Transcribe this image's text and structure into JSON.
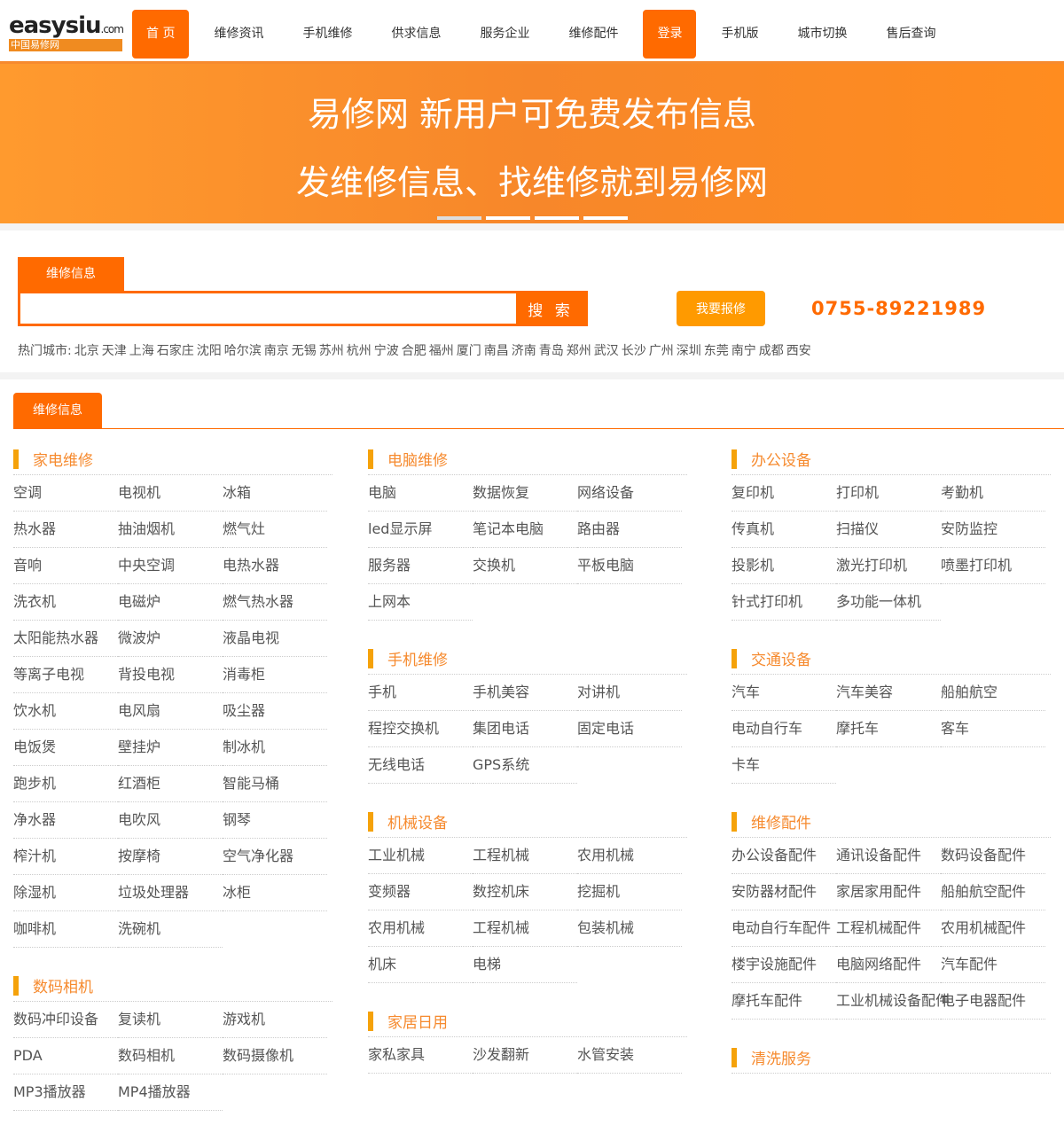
{
  "logo": {
    "text": "easysiu",
    "suffix": ".com",
    "sub": "中国易修网"
  },
  "nav": [
    "首 页",
    "维修资讯",
    "手机维修",
    "供求信息",
    "服务企业",
    "维修配件",
    "登录",
    "手机版",
    "城市切换",
    "售后查询"
  ],
  "nav_active": [
    0,
    6
  ],
  "banner": {
    "line1": "易修网 新用户可免费发布信息",
    "line2": "发维修信息、找维修就到易修网"
  },
  "search": {
    "tab": "维修信息",
    "placeholder": "",
    "button": "搜 索",
    "report": "我要报修",
    "phone": "0755-89221989"
  },
  "hot": {
    "label": "热门城市:",
    "cities": [
      "北京",
      "天津",
      "上海",
      "石家庄",
      "沈阳",
      "哈尔滨",
      "南京",
      "无锡",
      "苏州",
      "杭州",
      "宁波",
      "合肥",
      "福州",
      "厦门",
      "南昌",
      "济南",
      "青岛",
      "郑州",
      "武汉",
      "长沙",
      "广州",
      "深圳",
      "东莞",
      "南宁",
      "成都",
      "西安"
    ]
  },
  "main": {
    "tab": "维修信息"
  },
  "columns": [
    [
      {
        "title": "家电维修",
        "items": [
          "空调",
          "电视机",
          "冰箱",
          "热水器",
          "抽油烟机",
          "燃气灶",
          "音响",
          "中央空调",
          "电热水器",
          "洗衣机",
          "电磁炉",
          "燃气热水器",
          "太阳能热水器",
          "微波炉",
          "液晶电视",
          "等离子电视",
          "背投电视",
          "消毒柜",
          "饮水机",
          "电风扇",
          "吸尘器",
          "电饭煲",
          "壁挂炉",
          "制冰机",
          "跑步机",
          "红酒柜",
          "智能马桶",
          "净水器",
          "电吹风",
          "钢琴",
          "榨汁机",
          "按摩椅",
          "空气净化器",
          "除湿机",
          "垃圾处理器",
          "冰柜",
          "咖啡机",
          "洗碗机"
        ]
      },
      {
        "title": "数码相机",
        "items": [
          "数码冲印设备",
          "复读机",
          "游戏机",
          "PDA",
          "数码相机",
          "数码摄像机",
          "MP3播放器",
          "MP4播放器"
        ]
      }
    ],
    [
      {
        "title": "电脑维修",
        "items": [
          "电脑",
          "数据恢复",
          "网络设备",
          "led显示屏",
          "笔记本电脑",
          "路由器",
          "服务器",
          "交换机",
          "平板电脑",
          "上网本"
        ]
      },
      {
        "title": "手机维修",
        "items": [
          "手机",
          "手机美容",
          "对讲机",
          "程控交换机",
          "集团电话",
          "固定电话",
          "无线电话",
          "GPS系统"
        ]
      },
      {
        "title": "机械设备",
        "items": [
          "工业机械",
          "工程机械",
          "农用机械",
          "变频器",
          "数控机床",
          "挖掘机",
          "农用机械",
          "工程机械",
          "包装机械",
          "机床",
          "电梯"
        ]
      },
      {
        "title": "家居日用",
        "items": [
          "家私家具",
          "沙发翻新",
          "水管安装"
        ]
      }
    ],
    [
      {
        "title": "办公设备",
        "items": [
          "复印机",
          "打印机",
          "考勤机",
          "传真机",
          "扫描仪",
          "安防监控",
          "投影机",
          "激光打印机",
          "喷墨打印机",
          "针式打印机",
          "多功能一体机"
        ]
      },
      {
        "title": "交通设备",
        "items": [
          "汽车",
          "汽车美容",
          "船舶航空",
          "电动自行车",
          "摩托车",
          "客车",
          "卡车"
        ]
      },
      {
        "title": "维修配件",
        "items": [
          "办公设备配件",
          "通讯设备配件",
          "数码设备配件",
          "安防器材配件",
          "家居家用配件",
          "船舶航空配件",
          "电动自行车配件",
          "工程机械配件",
          "农用机械配件",
          "楼宇设施配件",
          "电脑网络配件",
          "汽车配件",
          "摩托车配件",
          "工业机械设备配件",
          "电子电器配件"
        ]
      },
      {
        "title": "清洗服务",
        "items": []
      }
    ]
  ],
  "colors": {
    "accent": "#ff6a00",
    "bar": "#f5a20a",
    "heading": "#f68a2e"
  }
}
